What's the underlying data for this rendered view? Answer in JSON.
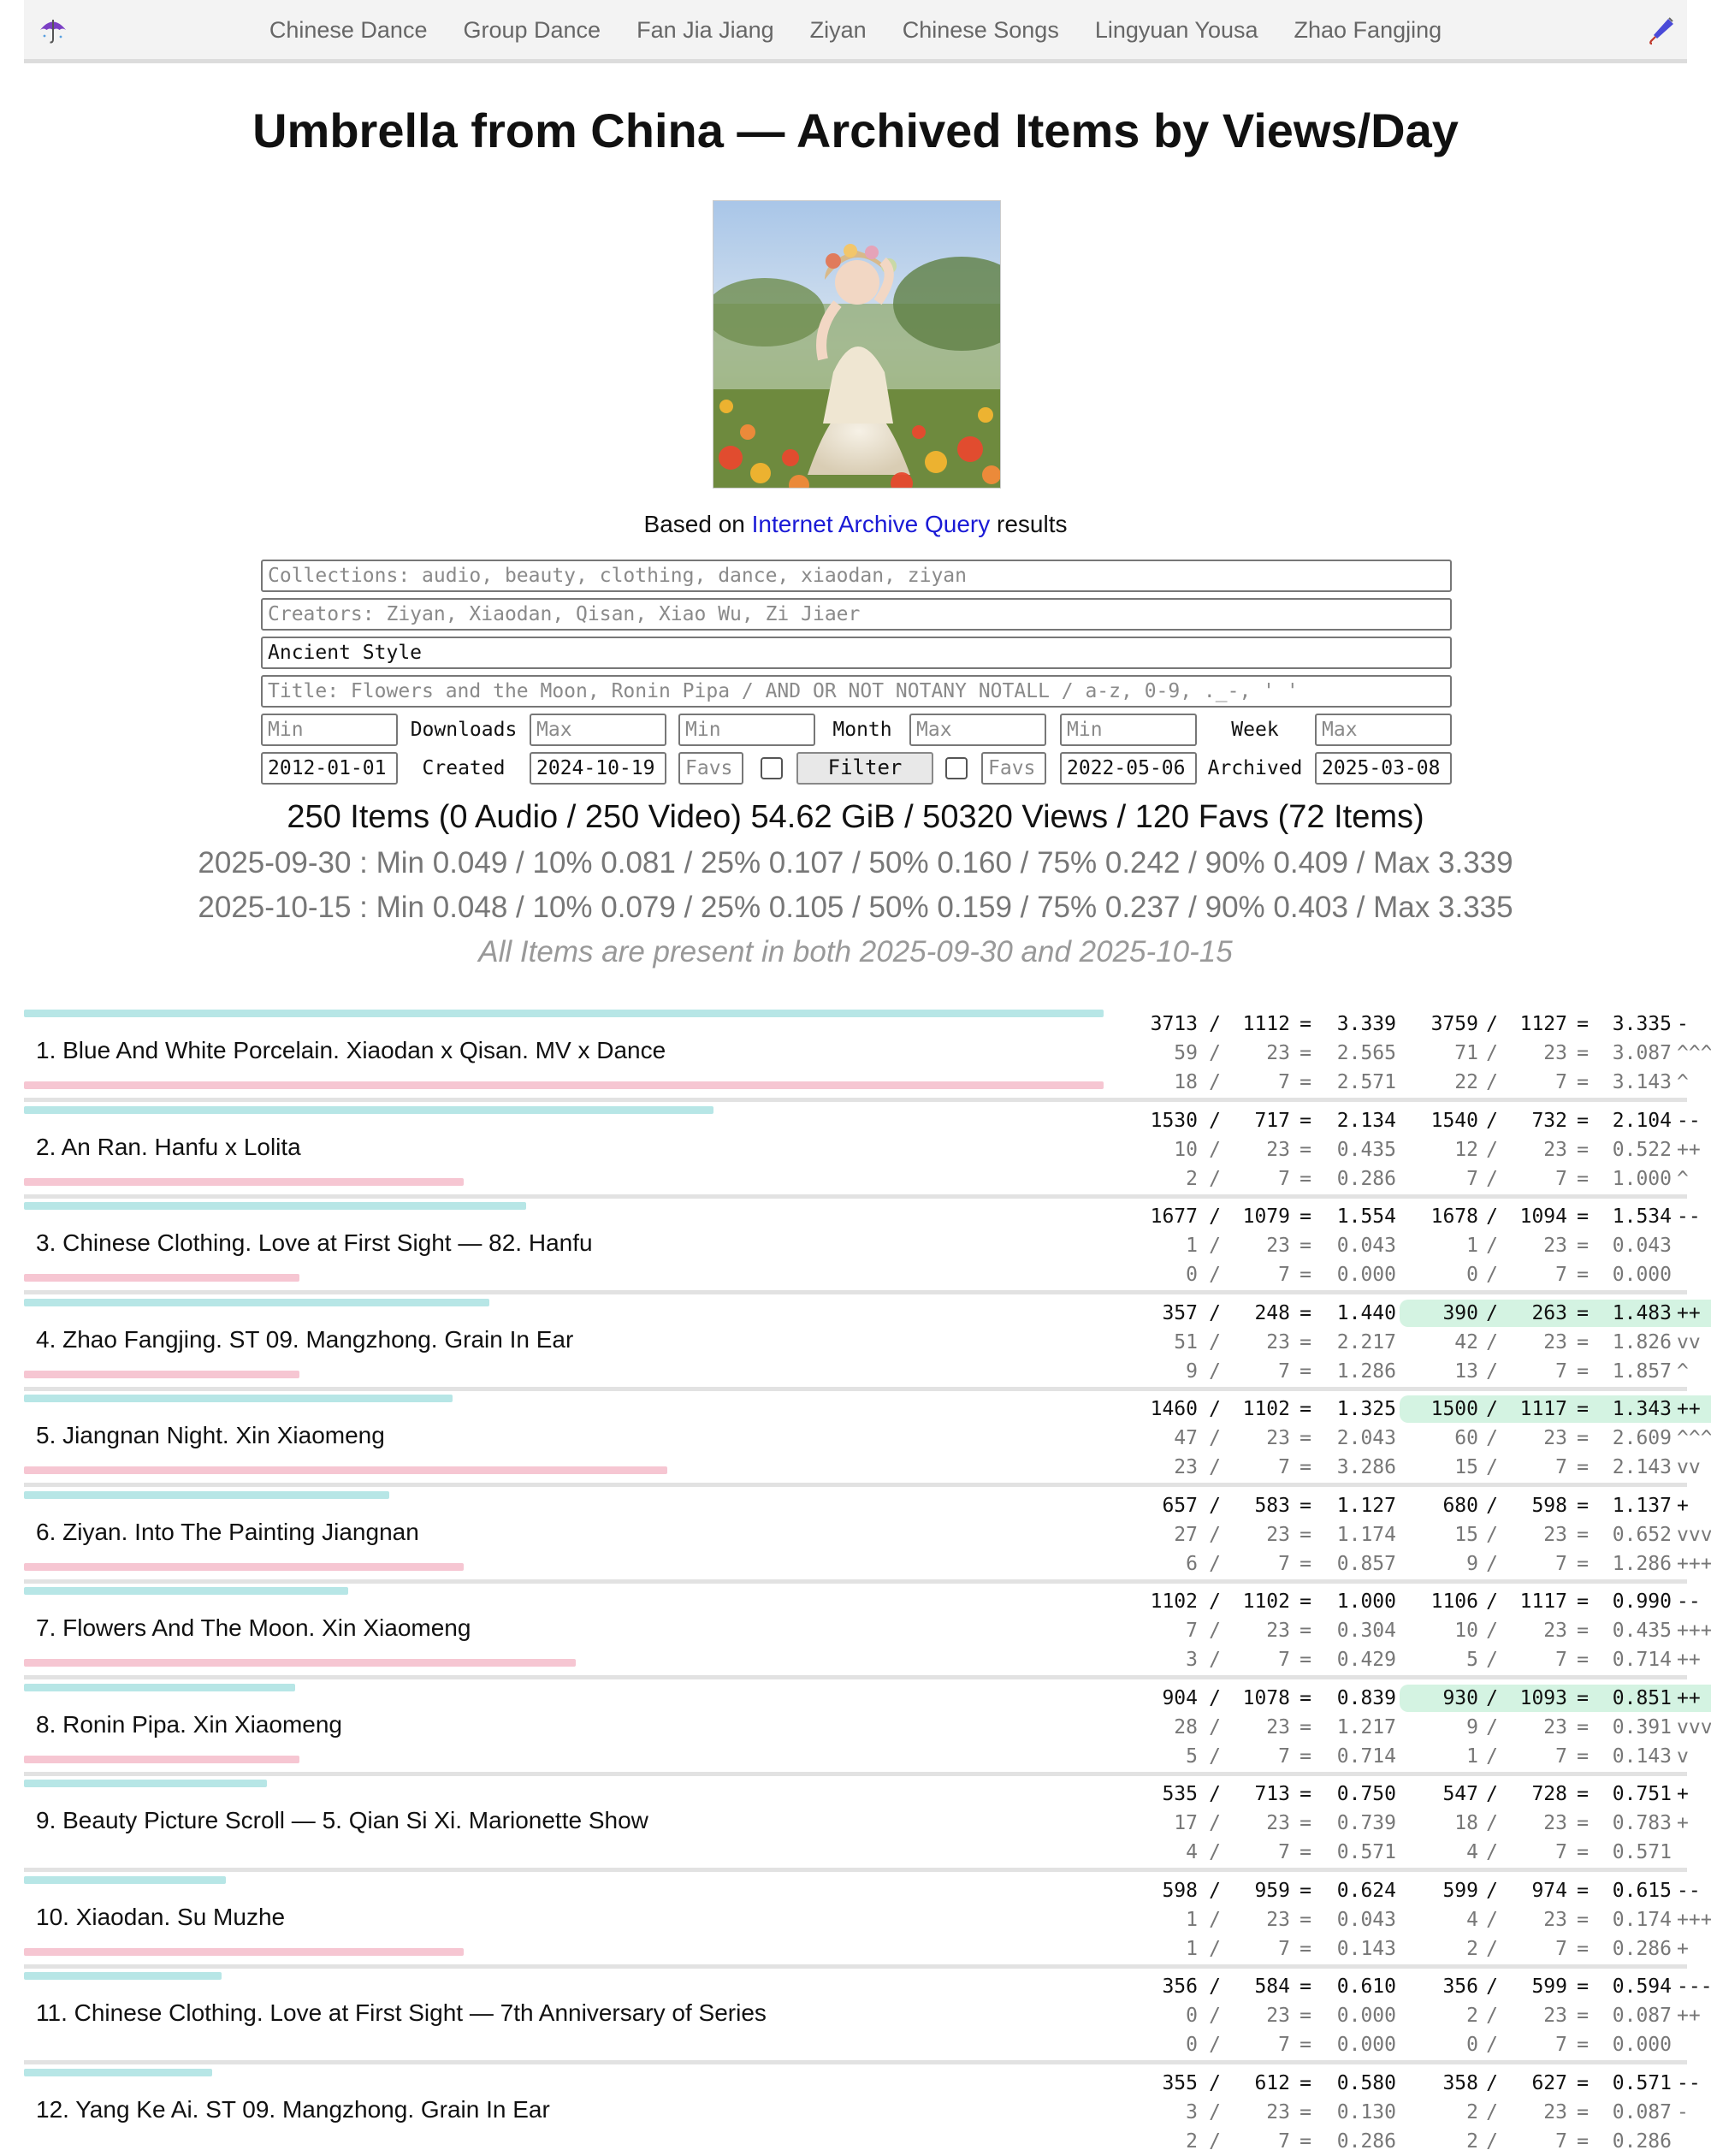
{
  "nav": {
    "links": [
      "Chinese Dance",
      "Group Dance",
      "Fan Jia Jiang",
      "Ziyan",
      "Chinese Songs",
      "Lingyuan Yousa",
      "Zhao Fangjing"
    ],
    "left_icon": "umbrella-icon",
    "right_icon": "closed-umbrella-icon"
  },
  "page": {
    "title": "Umbrella from China — Archived Items by Views/Day",
    "based_on_prefix": "Based on ",
    "based_on_link": "Internet Archive Query",
    "based_on_suffix": " results"
  },
  "form": {
    "collections_placeholder": "Collections: audio, beauty, clothing, dance, xiaodan, ziyan",
    "creators_placeholder": "Creators: Ziyan, Xiaodan, Qisan, Xiao Wu, Zi Jiaer",
    "subject_value": "Ancient Style",
    "title_placeholder": "Title: Flowers and the Moon, Ronin Pipa / AND OR NOT NOTANY NOTALL / a-z, 0-9, ._-, ' '",
    "min_placeholder": "Min",
    "max_placeholder": "Max",
    "downloads_label": "Downloads",
    "month_label": "Month",
    "week_label": "Week",
    "created_label": "Created",
    "archived_label": "Archived",
    "created_from": "2012-01-01",
    "created_to": "2024-10-19",
    "favs_placeholder": "Favs",
    "filter_label": "Filter",
    "archived_from": "2022-05-06",
    "archived_to": "2025-03-08"
  },
  "summary": {
    "main": "250 Items (0 Audio / 250 Video) 54.62 GiB / 50320 Views / 120 Favs (72 Items)",
    "q1": "2025-09-30 : Min 0.049 / 10% 0.081 / 25% 0.107 / 50% 0.160 / 75% 0.242 / 90% 0.409 / Max 3.339",
    "q2": "2025-10-15 : Min 0.048 / 10% 0.079 / 25% 0.105 / 50% 0.159 / 75% 0.237 / 90% 0.403 / Max 3.335",
    "note": "All Items are present in both 2025-09-30 and 2025-10-15"
  },
  "items": [
    {
      "title": "1. Blue And White Porcelain. Xiaodan x Qisan. MV x Dance",
      "views_per_day_fraction": 1.0,
      "week_fraction": 1.0,
      "highlight": false,
      "rows": [
        [
          "3713",
          "1112",
          "3.339",
          "3759",
          "1127",
          "3.335",
          "-"
        ],
        [
          "59",
          "23",
          "2.565",
          "71",
          "23",
          "3.087",
          "^^^"
        ],
        [
          "18",
          "7",
          "2.571",
          "22",
          "7",
          "3.143",
          "^"
        ]
      ]
    },
    {
      "title": "2. An Ran. Hanfu x Lolita",
      "views_per_day_fraction": 0.639,
      "week_fraction": 0.407,
      "highlight": false,
      "rows": [
        [
          "1530",
          "717",
          "2.134",
          "1540",
          "732",
          "2.104",
          "--"
        ],
        [
          "10",
          "23",
          "0.435",
          "12",
          "23",
          "0.522",
          "++"
        ],
        [
          "2",
          "7",
          "0.286",
          "7",
          "7",
          "1.000",
          "^"
        ]
      ]
    },
    {
      "title": "3. Chinese Clothing. Love at First Sight — 82. Hanfu",
      "views_per_day_fraction": 0.465,
      "week_fraction": 0.255,
      "highlight": false,
      "rows": [
        [
          "1677",
          "1079",
          "1.554",
          "1678",
          "1094",
          "1.534",
          "--"
        ],
        [
          "1",
          "23",
          "0.043",
          "1",
          "23",
          "0.043",
          ""
        ],
        [
          "0",
          "7",
          "0.000",
          "0",
          "7",
          "0.000",
          ""
        ]
      ]
    },
    {
      "title": "4. Zhao Fangjing. ST 09. Mangzhong. Grain In Ear",
      "views_per_day_fraction": 0.431,
      "week_fraction": 0.255,
      "highlight": true,
      "rows": [
        [
          "357",
          "248",
          "1.440",
          "390",
          "263",
          "1.483",
          "++"
        ],
        [
          "51",
          "23",
          "2.217",
          "42",
          "23",
          "1.826",
          "vv"
        ],
        [
          "9",
          "7",
          "1.286",
          "13",
          "7",
          "1.857",
          "^"
        ]
      ]
    },
    {
      "title": "5. Jiangnan Night. Xin Xiaomeng",
      "views_per_day_fraction": 0.397,
      "week_fraction": 0.596,
      "highlight": true,
      "rows": [
        [
          "1460",
          "1102",
          "1.325",
          "1500",
          "1117",
          "1.343",
          "++"
        ],
        [
          "47",
          "23",
          "2.043",
          "60",
          "23",
          "2.609",
          "^^^"
        ],
        [
          "23",
          "7",
          "3.286",
          "15",
          "7",
          "2.143",
          "vv"
        ]
      ]
    },
    {
      "title": "6. Ziyan. Into The Painting Jiangnan",
      "views_per_day_fraction": 0.338,
      "week_fraction": 0.407,
      "highlight": false,
      "rows": [
        [
          "657",
          "583",
          "1.127",
          "680",
          "598",
          "1.137",
          "+"
        ],
        [
          "27",
          "23",
          "1.174",
          "15",
          "23",
          "0.652",
          "vvv"
        ],
        [
          "6",
          "7",
          "0.857",
          "9",
          "7",
          "1.286",
          "+++"
        ]
      ]
    },
    {
      "title": "7. Flowers And The Moon. Xin Xiaomeng",
      "views_per_day_fraction": 0.3,
      "week_fraction": 0.511,
      "highlight": false,
      "rows": [
        [
          "1102",
          "1102",
          "1.000",
          "1106",
          "1117",
          "0.990",
          "--"
        ],
        [
          "7",
          "23",
          "0.304",
          "10",
          "23",
          "0.435",
          "+++"
        ],
        [
          "3",
          "7",
          "0.429",
          "5",
          "7",
          "0.714",
          "++"
        ]
      ]
    },
    {
      "title": "8. Ronin Pipa. Xin Xiaomeng",
      "views_per_day_fraction": 0.251,
      "week_fraction": 0.255,
      "highlight": true,
      "rows": [
        [
          "904",
          "1078",
          "0.839",
          "930",
          "1093",
          "0.851",
          "++"
        ],
        [
          "28",
          "23",
          "1.217",
          "9",
          "23",
          "0.391",
          "vvv"
        ],
        [
          "5",
          "7",
          "0.714",
          "1",
          "7",
          "0.143",
          "v"
        ]
      ]
    },
    {
      "title": "9. Beauty Picture Scroll — 5. Qian Si Xi. Marionette Show",
      "views_per_day_fraction": 0.225,
      "week_fraction": 0.0,
      "highlight": false,
      "rows": [
        [
          "535",
          "713",
          "0.750",
          "547",
          "728",
          "0.751",
          "+"
        ],
        [
          "17",
          "23",
          "0.739",
          "18",
          "23",
          "0.783",
          "+"
        ],
        [
          "4",
          "7",
          "0.571",
          "4",
          "7",
          "0.571",
          ""
        ]
      ]
    },
    {
      "title": "10. Xiaodan. Su Muzhe",
      "views_per_day_fraction": 0.187,
      "week_fraction": 0.407,
      "highlight": false,
      "rows": [
        [
          "598",
          "959",
          "0.624",
          "599",
          "974",
          "0.615",
          "--"
        ],
        [
          "1",
          "23",
          "0.043",
          "4",
          "23",
          "0.174",
          "+++"
        ],
        [
          "1",
          "7",
          "0.143",
          "2",
          "7",
          "0.286",
          "+"
        ]
      ]
    },
    {
      "title": "11. Chinese Clothing. Love at First Sight — 7th Anniversary of Series",
      "views_per_day_fraction": 0.183,
      "week_fraction": 0.0,
      "highlight": false,
      "rows": [
        [
          "356",
          "584",
          "0.610",
          "356",
          "599",
          "0.594",
          "---"
        ],
        [
          "0",
          "23",
          "0.000",
          "2",
          "23",
          "0.087",
          "++"
        ],
        [
          "0",
          "7",
          "0.000",
          "0",
          "7",
          "0.000",
          ""
        ]
      ]
    },
    {
      "title": "12. Yang Ke Ai. ST 09. Mangzhong. Grain In Ear",
      "views_per_day_fraction": 0.174,
      "week_fraction": 0.0,
      "highlight": false,
      "rows": [
        [
          "355",
          "612",
          "0.580",
          "358",
          "627",
          "0.571",
          "--"
        ],
        [
          "3",
          "23",
          "0.130",
          "2",
          "23",
          "0.087",
          "-"
        ],
        [
          "2",
          "7",
          "0.286",
          "2",
          "7",
          "0.286",
          ""
        ]
      ]
    }
  ]
}
